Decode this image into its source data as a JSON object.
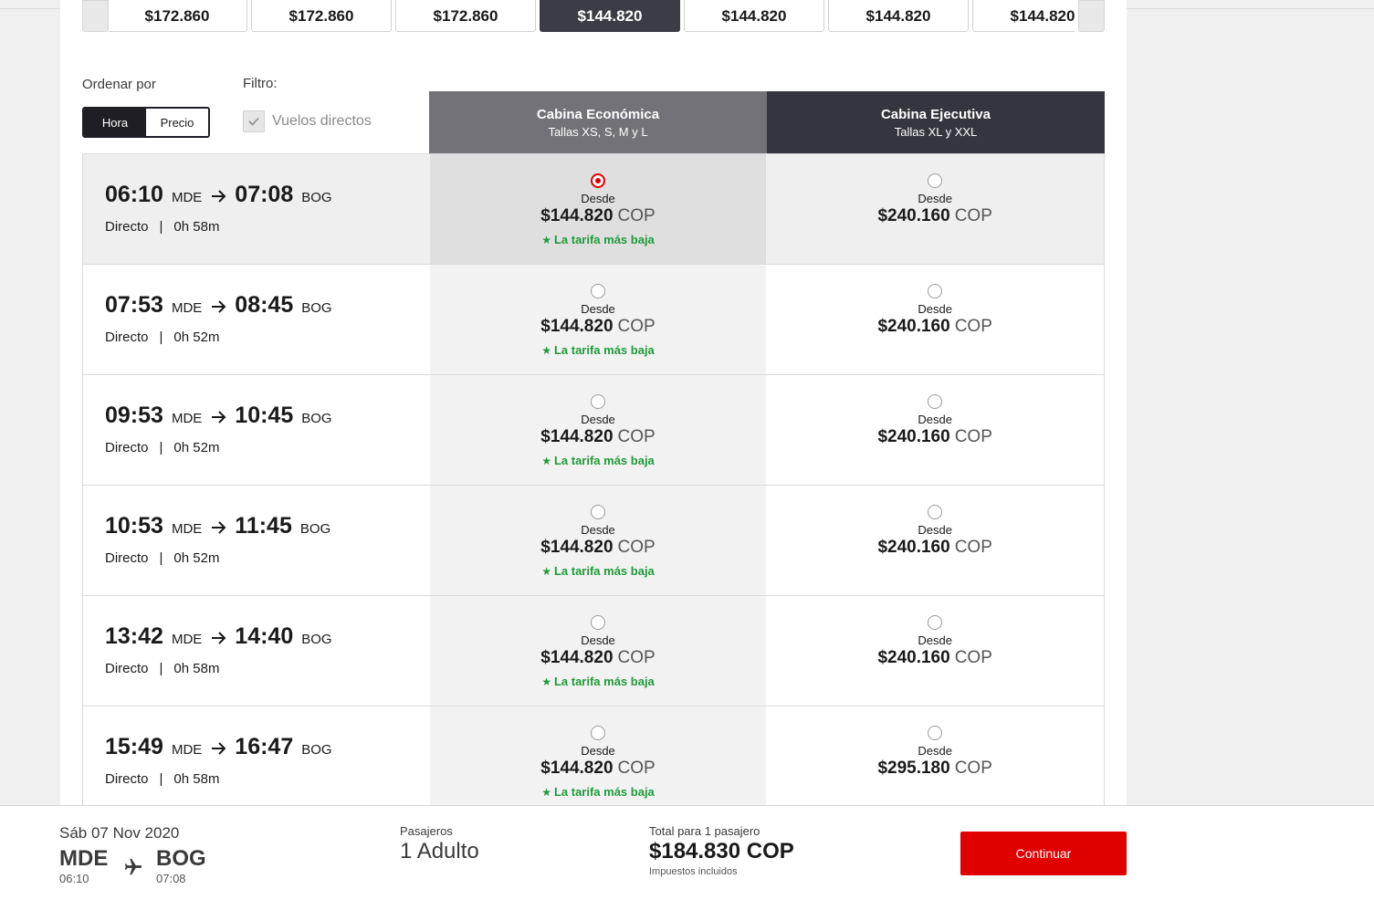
{
  "carousel": {
    "days": [
      {
        "price": "$172.860"
      },
      {
        "price": "$172.860"
      },
      {
        "price": "$172.860"
      },
      {
        "price": "$144.820"
      },
      {
        "price": "$144.820"
      },
      {
        "price": "$144.820"
      },
      {
        "price": "$144.820"
      }
    ],
    "selected_index": 3
  },
  "sort": {
    "label": "Ordenar por",
    "options": [
      "Hora",
      "Precio"
    ],
    "active": "Hora"
  },
  "filter": {
    "label": "Filtro:",
    "direct_label": "Vuelos directos",
    "direct_checked": true
  },
  "cabins": {
    "economy": {
      "title": "Cabina Económica",
      "subtitle": "Tallas XS, S, M y L"
    },
    "executive": {
      "title": "Cabina Ejecutiva",
      "subtitle": "Tallas XL y XXL"
    }
  },
  "fare_labels": {
    "from": "Desde",
    "currency": "COP",
    "lowest": "La tarifa más baja"
  },
  "flights": [
    {
      "dep_time": "06:10",
      "origin": "MDE",
      "arr_time": "07:08",
      "dest": "BOG",
      "type": "Directo",
      "duration": "0h 58m",
      "eco_price": "$144.820",
      "exe_price": "$240.160",
      "eco_lowest": true,
      "selected": true
    },
    {
      "dep_time": "07:53",
      "origin": "MDE",
      "arr_time": "08:45",
      "dest": "BOG",
      "type": "Directo",
      "duration": "0h 52m",
      "eco_price": "$144.820",
      "exe_price": "$240.160",
      "eco_lowest": true,
      "selected": false
    },
    {
      "dep_time": "09:53",
      "origin": "MDE",
      "arr_time": "10:45",
      "dest": "BOG",
      "type": "Directo",
      "duration": "0h 52m",
      "eco_price": "$144.820",
      "exe_price": "$240.160",
      "eco_lowest": true,
      "selected": false
    },
    {
      "dep_time": "10:53",
      "origin": "MDE",
      "arr_time": "11:45",
      "dest": "BOG",
      "type": "Directo",
      "duration": "0h 52m",
      "eco_price": "$144.820",
      "exe_price": "$240.160",
      "eco_lowest": true,
      "selected": false
    },
    {
      "dep_time": "13:42",
      "origin": "MDE",
      "arr_time": "14:40",
      "dest": "BOG",
      "type": "Directo",
      "duration": "0h 58m",
      "eco_price": "$144.820",
      "exe_price": "$240.160",
      "eco_lowest": true,
      "selected": false
    },
    {
      "dep_time": "15:49",
      "origin": "MDE",
      "arr_time": "16:47",
      "dest": "BOG",
      "type": "Directo",
      "duration": "0h 58m",
      "eco_price": "$144.820",
      "exe_price": "$295.180",
      "eco_lowest": true,
      "selected": false
    }
  ],
  "footer": {
    "date": "Sáb 07 Nov 2020",
    "origin": "MDE",
    "origin_time": "06:10",
    "dest": "BOG",
    "dest_time": "07:08",
    "pax_label": "Pasajeros",
    "pax_value": "1 Adulto",
    "total_label": "Total para 1 pasajero",
    "total_value": "$184.830 COP",
    "tax_note": "Impuestos incluidos",
    "continue_label": "Continuar"
  },
  "colors": {
    "accent": "#e00000",
    "dark": "#1e1e24",
    "economy_header": "#727278",
    "executive_header": "#35353d",
    "lowest_green": "#1f9a3a"
  }
}
